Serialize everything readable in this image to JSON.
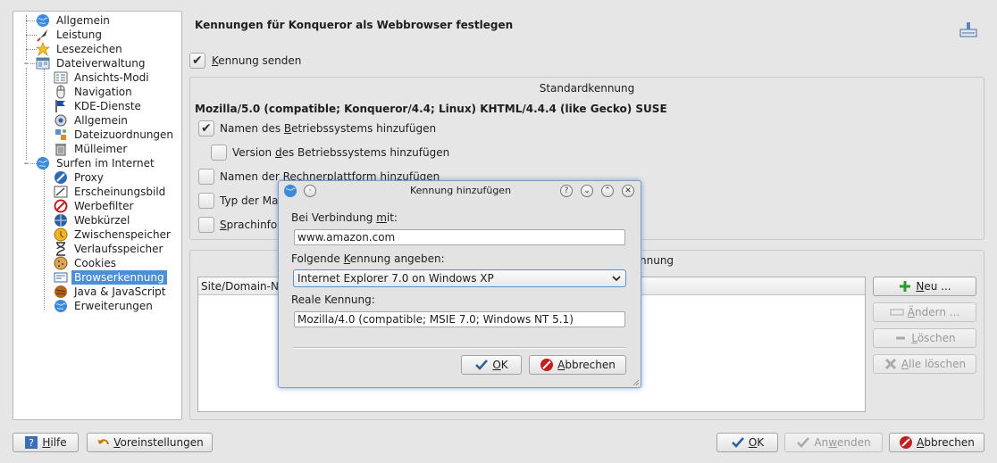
{
  "tree": {
    "items": [
      {
        "label": "Allgemein",
        "icon": "globe-icon"
      },
      {
        "label": "Leistung",
        "icon": "rocket-icon"
      },
      {
        "label": "Lesezeichen",
        "icon": "star-icon"
      },
      {
        "label": "Dateiverwaltung",
        "icon": "file-manager-icon"
      },
      {
        "label": "Ansichts-Modi",
        "icon": "view-modes-icon"
      },
      {
        "label": "Navigation",
        "icon": "mouse-icon"
      },
      {
        "label": "KDE-Dienste",
        "icon": "flag-icon"
      },
      {
        "label": "Allgemein",
        "icon": "gear-eye-icon"
      },
      {
        "label": "Dateizuordnungen",
        "icon": "file-associations-icon"
      },
      {
        "label": "Mülleimer",
        "icon": "trash-icon"
      },
      {
        "label": "Surfen im Internet",
        "icon": "globe-icon"
      },
      {
        "label": "Proxy",
        "icon": "proxy-icon"
      },
      {
        "label": "Erscheinungsbild",
        "icon": "appearance-icon"
      },
      {
        "label": "Werbefilter",
        "icon": "no-entry-icon"
      },
      {
        "label": "Webkürzel",
        "icon": "web-shortcuts-icon"
      },
      {
        "label": "Zwischenspeicher",
        "icon": "cache-icon"
      },
      {
        "label": "Verlaufsspeicher",
        "icon": "hourglass-icon"
      },
      {
        "label": "Cookies",
        "icon": "cookie-icon"
      },
      {
        "label": "Browserkennung",
        "icon": "browser-id-icon"
      },
      {
        "label": "Java & JavaScript",
        "icon": "java-icon"
      },
      {
        "label": "Erweiterungen",
        "icon": "globe-icon"
      }
    ],
    "selected": "Browserkennung"
  },
  "main": {
    "title": "Kennungen für Konqueror als Webbrowser festlegen",
    "send_id": {
      "label_pre": "",
      "label_u": "K",
      "label_post": "ennung senden",
      "checked": true
    },
    "standard_group": {
      "title": "Standardkennung",
      "ua_string": "Mozilla/5.0 (compatible; Konqueror/4.4; Linux) KHTML/4.4.4 (like Gecko) SUSE",
      "opt_os_name": {
        "label_pre": "Namen des ",
        "label_u": "B",
        "label_post": "etriebssystems hinzufügen",
        "checked": true
      },
      "opt_os_version": {
        "label_pre": "Version ",
        "label_u": "d",
        "label_post": "es Betriebssystems hinzufügen",
        "checked": false
      },
      "opt_platform": {
        "label_pre": "Namen der ",
        "label_u": "R",
        "label_post": "echnerplattform hinzufügen",
        "checked": false
      },
      "opt_machine": {
        "label": "Typ der Mas",
        "checked": false
      },
      "opt_lang": {
        "label_u": "S",
        "label_post": "prachinfor",
        "checked": false
      }
    },
    "site_group": {
      "title_visible": "nnung"
    },
    "table": {
      "col1": "Site/Domain-N"
    },
    "buttons": {
      "new": {
        "label_u": "N",
        "label_post": "eu ..."
      },
      "change": {
        "label_u": "Ä",
        "label_post": "ndern ..."
      },
      "delete": {
        "label_u": "L",
        "label_post": "öschen"
      },
      "delete_all": {
        "label_u": "A",
        "label_post": "lle löschen"
      }
    }
  },
  "bottom": {
    "help": {
      "label_u": "H",
      "label_post": "ilfe"
    },
    "defaults": {
      "label_u": "V",
      "label_post": "oreinstellungen"
    },
    "ok": {
      "label_u": "O",
      "label_post": "K"
    },
    "apply": {
      "label_pre": "An",
      "label_u": "w",
      "label_post": "enden"
    },
    "cancel": {
      "label_u": "A",
      "label_post": "bbrechen"
    }
  },
  "dialog": {
    "title": "Kennung hinzufügen",
    "conn_label_pre": "Bei Verbindung ",
    "conn_label_u": "m",
    "conn_label_post": "it:",
    "conn_value": "www.amazon.com",
    "id_label_pre": "Folgende ",
    "id_label_u": "K",
    "id_label_post": "ennung angeben:",
    "id_value": "Internet Explorer 7.0 on Windows XP",
    "real_label": "Reale Kennung:",
    "real_value": "Mozilla/4.0 (compatible; MSIE 7.0; Windows NT 5.1)",
    "ok": {
      "label_u": "O",
      "label_post": "K"
    },
    "cancel": {
      "label_u": "A",
      "label_post": "bbrechen"
    },
    "title_buttons": [
      "?",
      "⌄",
      "⌃",
      "✕"
    ]
  },
  "colors": {
    "selection": "#4a90d9",
    "dialog_border": "#7c9ec6",
    "background": "#e6e6e6"
  }
}
